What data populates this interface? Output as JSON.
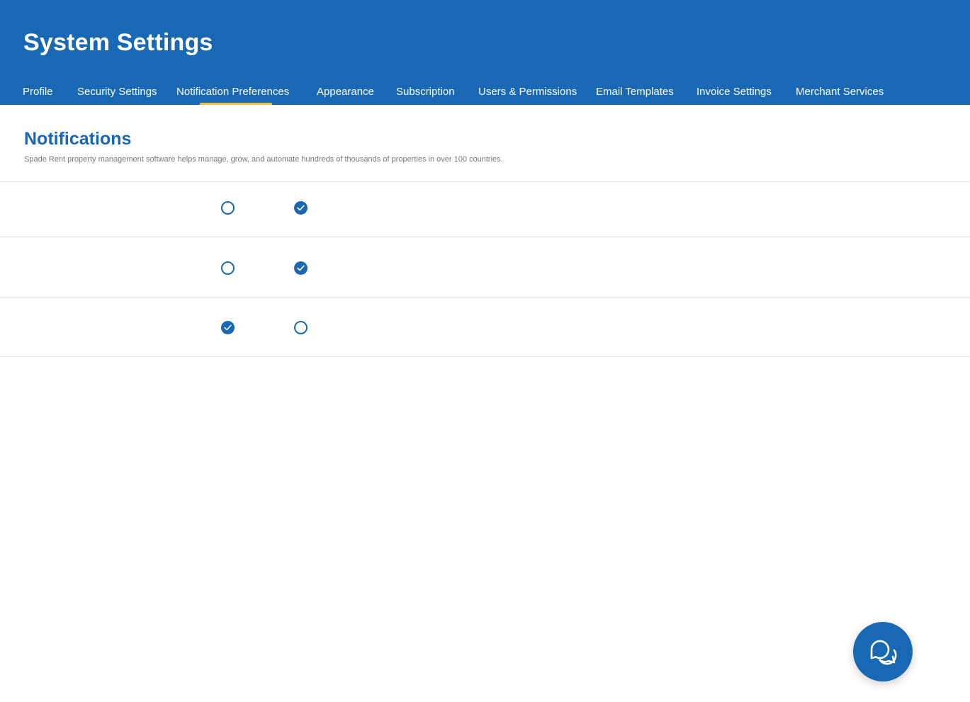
{
  "header": {
    "title": "System Settings",
    "tabs": [
      {
        "label": "Profile"
      },
      {
        "label": "Security Settings"
      },
      {
        "label": "Notification Preferences",
        "active": true
      },
      {
        "label": "Appearance"
      },
      {
        "label": "Subscription"
      },
      {
        "label": "Users & Permissions"
      },
      {
        "label": "Email Templates"
      },
      {
        "label": "Invoice Settings"
      },
      {
        "label": "Merchant Services"
      }
    ]
  },
  "notifications": {
    "title": "Notifications",
    "description": "Spade Rent property management software helps manage, grow, and automate hundreds of thousands of properties in over 100 countries.",
    "rows": [
      {
        "option_1_selected": false,
        "option_2_selected": true
      },
      {
        "option_1_selected": false,
        "option_2_selected": true
      },
      {
        "option_1_selected": true,
        "option_2_selected": false
      }
    ]
  },
  "colors": {
    "primary": "#1868B3",
    "tab_indicator": "#F5C242",
    "description_text": "#777777",
    "divider": "#e3e3e3"
  },
  "icons": {
    "radio_checked": "check-icon",
    "chat_button": "chat-bubbles-icon"
  }
}
